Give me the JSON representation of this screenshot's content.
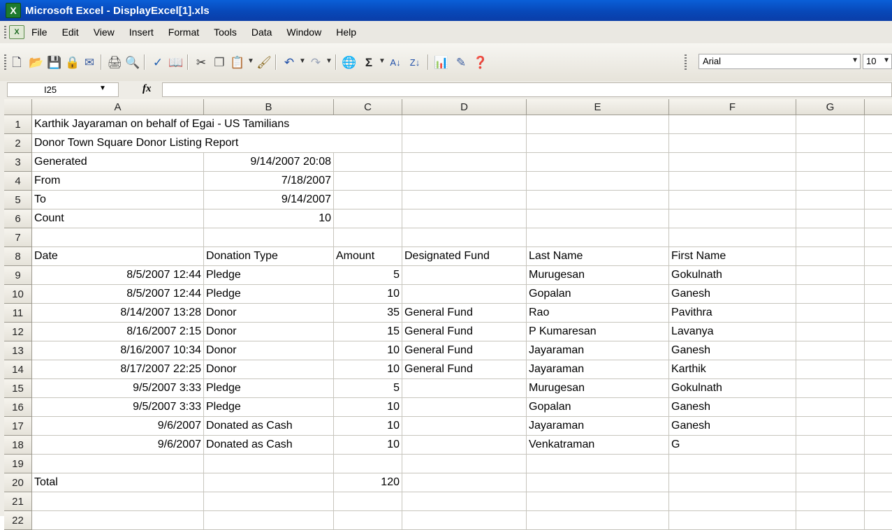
{
  "window": {
    "title": "Microsoft Excel - DisplayExcel[1].xls",
    "app_icon": "excel-icon"
  },
  "menu": {
    "items": [
      "File",
      "Edit",
      "View",
      "Insert",
      "Format",
      "Tools",
      "Data",
      "Window",
      "Help"
    ]
  },
  "toolbar": {
    "font": "Arial",
    "font_size": "10",
    "icons": [
      "new-icon",
      "open-icon",
      "save-icon",
      "permission-icon",
      "print-icon",
      "print-preview-icon",
      "spelling-icon",
      "research-icon",
      "cut-icon",
      "copy-icon",
      "paste-icon",
      "format-painter-icon",
      "undo-icon",
      "redo-icon",
      "hyperlink-icon",
      "autosum-icon",
      "sort-ascending-icon",
      "sort-descending-icon",
      "chart-wizard-icon",
      "drawing-icon",
      "help-icon"
    ]
  },
  "formula_bar": {
    "name_box": "I25",
    "fx_label": "fx",
    "formula": ""
  },
  "sheet": {
    "columns": [
      "A",
      "B",
      "C",
      "D",
      "E",
      "F",
      "G"
    ],
    "rows": [
      {
        "num": "1",
        "cells": [
          "Karthik Jayaraman on behalf of Egai - US Tamilians",
          "",
          "",
          "",
          "",
          "",
          ""
        ]
      },
      {
        "num": "2",
        "cells": [
          "Donor Town Square Donor Listing Report",
          "",
          "",
          "",
          "",
          "",
          ""
        ]
      },
      {
        "num": "3",
        "cells": [
          "Generated",
          "9/14/2007 20:08",
          "",
          "",
          "",
          "",
          ""
        ]
      },
      {
        "num": "4",
        "cells": [
          "From",
          "7/18/2007",
          "",
          "",
          "",
          "",
          ""
        ]
      },
      {
        "num": "5",
        "cells": [
          "To",
          "9/14/2007",
          "",
          "",
          "",
          "",
          ""
        ]
      },
      {
        "num": "6",
        "cells": [
          "Count",
          "10",
          "",
          "",
          "",
          "",
          ""
        ]
      },
      {
        "num": "7",
        "cells": [
          "",
          "",
          "",
          "",
          "",
          "",
          ""
        ]
      },
      {
        "num": "8",
        "cells": [
          "Date",
          "Donation Type",
          "Amount",
          "Designated Fund",
          "Last Name",
          "First Name",
          ""
        ]
      },
      {
        "num": "9",
        "cells": [
          "8/5/2007 12:44",
          "Pledge",
          "5",
          "",
          "Murugesan",
          "Gokulnath",
          ""
        ]
      },
      {
        "num": "10",
        "cells": [
          "8/5/2007 12:44",
          "Pledge",
          "10",
          "",
          "Gopalan",
          "Ganesh",
          ""
        ]
      },
      {
        "num": "11",
        "cells": [
          "8/14/2007 13:28",
          "Donor",
          "35",
          "General Fund",
          "Rao",
          "Pavithra",
          ""
        ]
      },
      {
        "num": "12",
        "cells": [
          "8/16/2007 2:15",
          "Donor",
          "15",
          "General Fund",
          "P Kumaresan",
          "Lavanya",
          ""
        ]
      },
      {
        "num": "13",
        "cells": [
          "8/16/2007 10:34",
          "Donor",
          "10",
          "General Fund",
          "Jayaraman",
          "Ganesh",
          ""
        ]
      },
      {
        "num": "14",
        "cells": [
          "8/17/2007 22:25",
          "Donor",
          "10",
          "General Fund",
          "Jayaraman",
          "Karthik",
          ""
        ]
      },
      {
        "num": "15",
        "cells": [
          "9/5/2007 3:33",
          "Pledge",
          "5",
          "",
          "Murugesan",
          "Gokulnath",
          ""
        ]
      },
      {
        "num": "16",
        "cells": [
          "9/5/2007 3:33",
          "Pledge",
          "10",
          "",
          "Gopalan",
          "Ganesh",
          ""
        ]
      },
      {
        "num": "17",
        "cells": [
          "9/6/2007",
          "Donated as Cash",
          "10",
          "",
          "Jayaraman",
          "Ganesh",
          ""
        ]
      },
      {
        "num": "18",
        "cells": [
          "9/6/2007",
          "Donated as Cash",
          "10",
          "",
          "Venkatraman",
          "G",
          ""
        ]
      },
      {
        "num": "19",
        "cells": [
          "",
          "",
          "",
          "",
          "",
          "",
          ""
        ]
      },
      {
        "num": "20",
        "cells": [
          "Total",
          "",
          "120",
          "",
          "",
          "",
          ""
        ]
      },
      {
        "num": "21",
        "cells": [
          "",
          "",
          "",
          "",
          "",
          "",
          ""
        ]
      },
      {
        "num": "22",
        "cells": [
          "",
          "",
          "",
          "",
          "",
          "",
          ""
        ]
      }
    ]
  }
}
